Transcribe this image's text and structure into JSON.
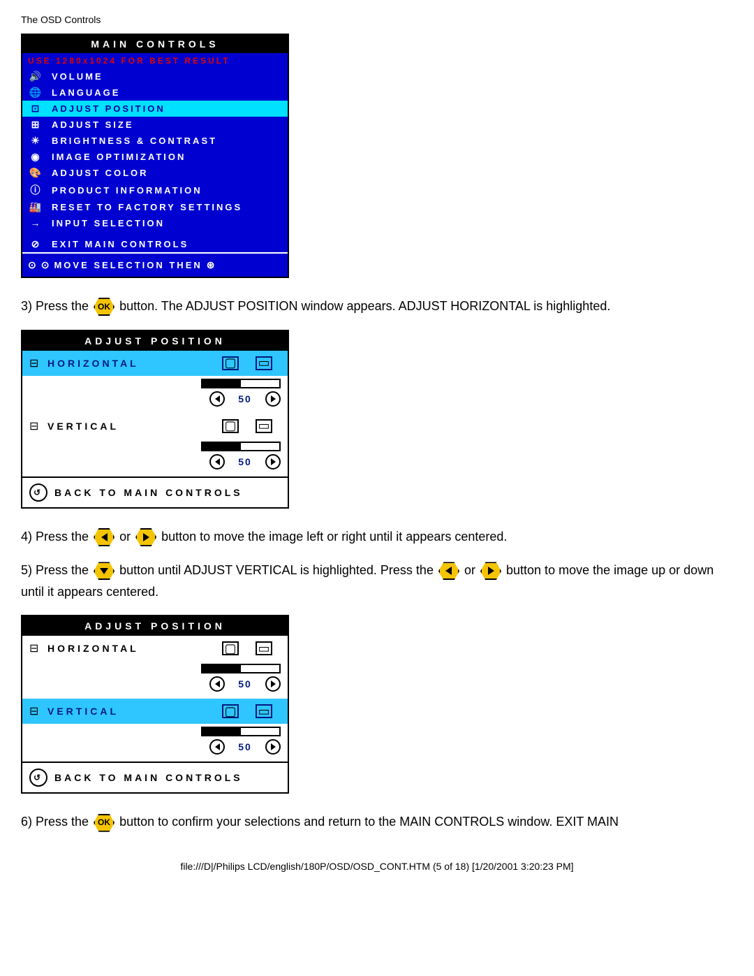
{
  "page": {
    "title": "The OSD Controls"
  },
  "osd_main": {
    "header": "MAIN CONTROLS",
    "note": "USE 1280x1024 FOR BEST RESULT",
    "items": [
      {
        "icon": "🔊",
        "label": "VOLUME",
        "highlight": false
      },
      {
        "icon": "🌐",
        "label": "LANGUAGE",
        "highlight": false
      },
      {
        "icon": "⊡",
        "label": "ADJUST POSITION",
        "highlight": true
      },
      {
        "icon": "⊞",
        "label": "ADJUST SIZE",
        "highlight": false
      },
      {
        "icon": "☀",
        "label": "BRIGHTNESS & CONTRAST",
        "highlight": false
      },
      {
        "icon": "◉",
        "label": "IMAGE OPTIMIZATION",
        "highlight": false
      },
      {
        "icon": "🎨",
        "label": "ADJUST COLOR",
        "highlight": false
      },
      {
        "icon": "ⓘ",
        "label": "PRODUCT INFORMATION",
        "highlight": false
      },
      {
        "icon": "🏭",
        "label": "RESET TO FACTORY SETTINGS",
        "highlight": false
      },
      {
        "icon": "→",
        "label": "INPUT SELECTION",
        "highlight": false
      },
      {
        "icon": "⊘",
        "label": "EXIT MAIN CONTROLS",
        "highlight": false
      }
    ],
    "footer": "MOVE SELECTION THEN"
  },
  "steps": {
    "s3a": "3) Press the ",
    "s3b": " button. The ADJUST POSITION window appears. ADJUST HORIZONTAL is highlighted.",
    "s4a": "4) Press the",
    "s4b": " or ",
    "s4c": " button to move the image left or right until it appears centered.",
    "s5a": "5) Press the ",
    "s5b": " button until ADJUST VERTICAL is highlighted. Press the ",
    "s5c": " or ",
    "s5d": " button to move the image up or down until it appears centered.",
    "s6a": "6) Press the ",
    "s6b": " button to confirm your selections and return to the MAIN CONTROLS window. EXIT MAIN"
  },
  "adj1": {
    "header": "ADJUST POSITION",
    "rows": [
      {
        "label": "HORIZONTAL",
        "value": 50,
        "highlight": true
      },
      {
        "label": "VERTICAL",
        "value": 50,
        "highlight": false
      }
    ],
    "back": "BACK TO MAIN CONTROLS"
  },
  "adj2": {
    "header": "ADJUST POSITION",
    "rows": [
      {
        "label": "HORIZONTAL",
        "value": 50,
        "highlight": false
      },
      {
        "label": "VERTICAL",
        "value": 50,
        "highlight": true
      }
    ],
    "back": "BACK TO MAIN CONTROLS"
  },
  "footer": {
    "path": "file:///D|/Philips LCD/english/180P/OSD/OSD_CONT.HTM (5 of 18) [1/20/2001 3:20:23 PM]"
  }
}
